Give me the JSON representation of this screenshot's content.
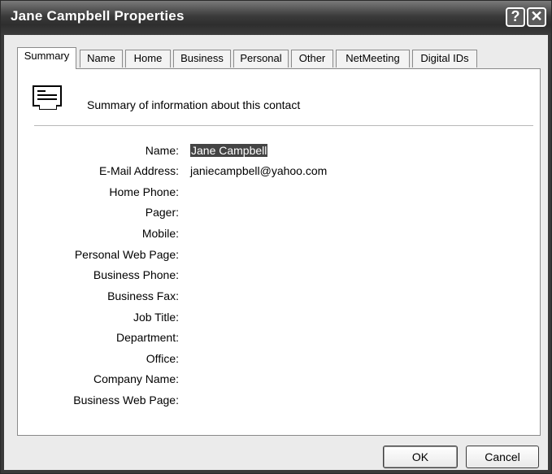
{
  "window": {
    "title": "Jane Campbell Properties",
    "help_glyph": "?",
    "close_glyph": "✕"
  },
  "tabs": [
    {
      "label": "Summary"
    },
    {
      "label": "Name"
    },
    {
      "label": "Home"
    },
    {
      "label": "Business"
    },
    {
      "label": "Personal"
    },
    {
      "label": "Other"
    },
    {
      "label": "NetMeeting"
    },
    {
      "label": "Digital IDs"
    }
  ],
  "active_tab": "Summary",
  "summary": {
    "heading": "Summary of information about this contact",
    "icon": "address-card-icon"
  },
  "fields": [
    {
      "label": "Name:",
      "value": "Jane Campbell",
      "selected": true
    },
    {
      "label": "E-Mail Address:",
      "value": "janiecampbell@yahoo.com"
    },
    {
      "label": "Home Phone:",
      "value": ""
    },
    {
      "label": "Pager:",
      "value": ""
    },
    {
      "label": "Mobile:",
      "value": ""
    },
    {
      "label": "Personal Web Page:",
      "value": ""
    },
    {
      "label": "Business Phone:",
      "value": ""
    },
    {
      "label": "Business Fax:",
      "value": ""
    },
    {
      "label": "Job Title:",
      "value": ""
    },
    {
      "label": "Department:",
      "value": ""
    },
    {
      "label": "Office:",
      "value": ""
    },
    {
      "label": "Company Name:",
      "value": ""
    },
    {
      "label": "Business Web Page:",
      "value": ""
    }
  ],
  "buttons": {
    "ok": "OK",
    "cancel": "Cancel"
  },
  "colors": {
    "titlebar": "#3a3a3a",
    "selection": "#444444"
  }
}
